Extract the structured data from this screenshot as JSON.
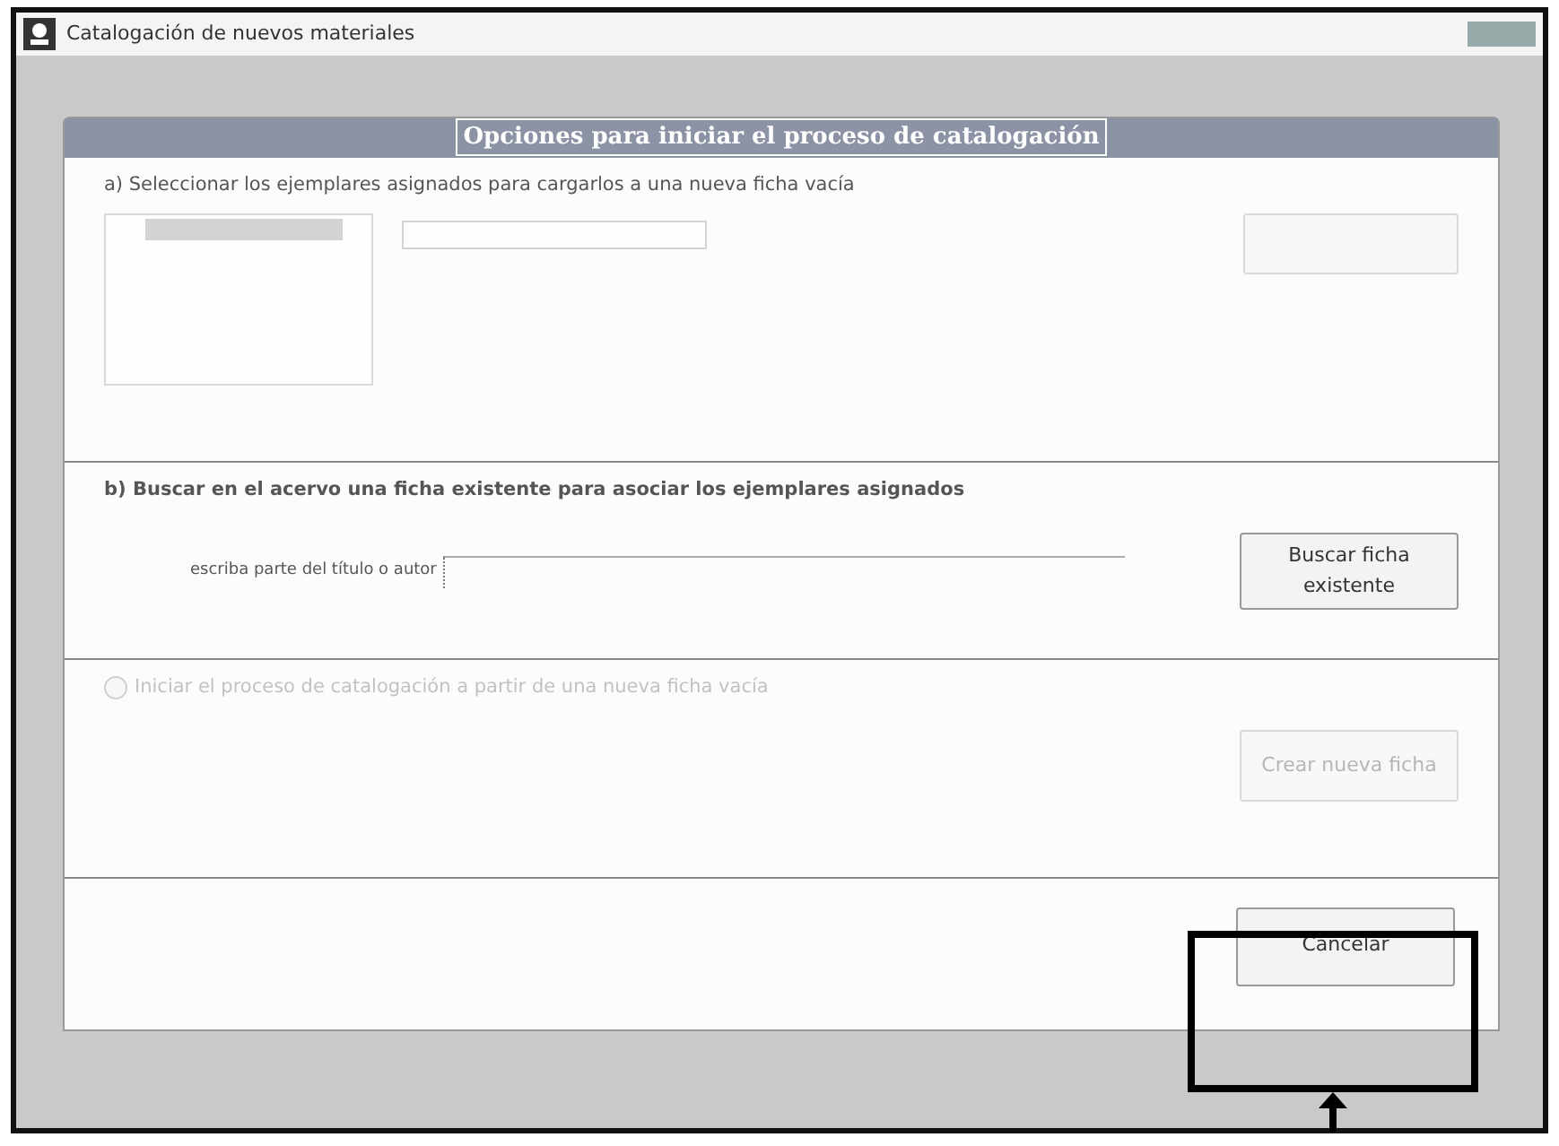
{
  "window": {
    "title": "Catalogación de nuevos materiales"
  },
  "panel_title": "Opciones para iniciar el proceso de catalogación",
  "section_a": {
    "title": "a) Seleccionar los ejemplares asignados para cargarlos a una nueva ficha vacía",
    "disabled": true
  },
  "section_b": {
    "title": "b) Buscar en el acervo una ficha existente para asociar los ejemplares asignados",
    "field_label": "escriba parte del título o autor",
    "button": "Buscar ficha existente"
  },
  "section_c": {
    "option": {
      "label": "Iniciar el proceso de catalogación a partir de una nueva ficha vacía",
      "checked": false,
      "disabled": true
    },
    "button": {
      "label": "Crear nueva ficha",
      "disabled": true
    }
  },
  "cancel_button": "Cancelar"
}
